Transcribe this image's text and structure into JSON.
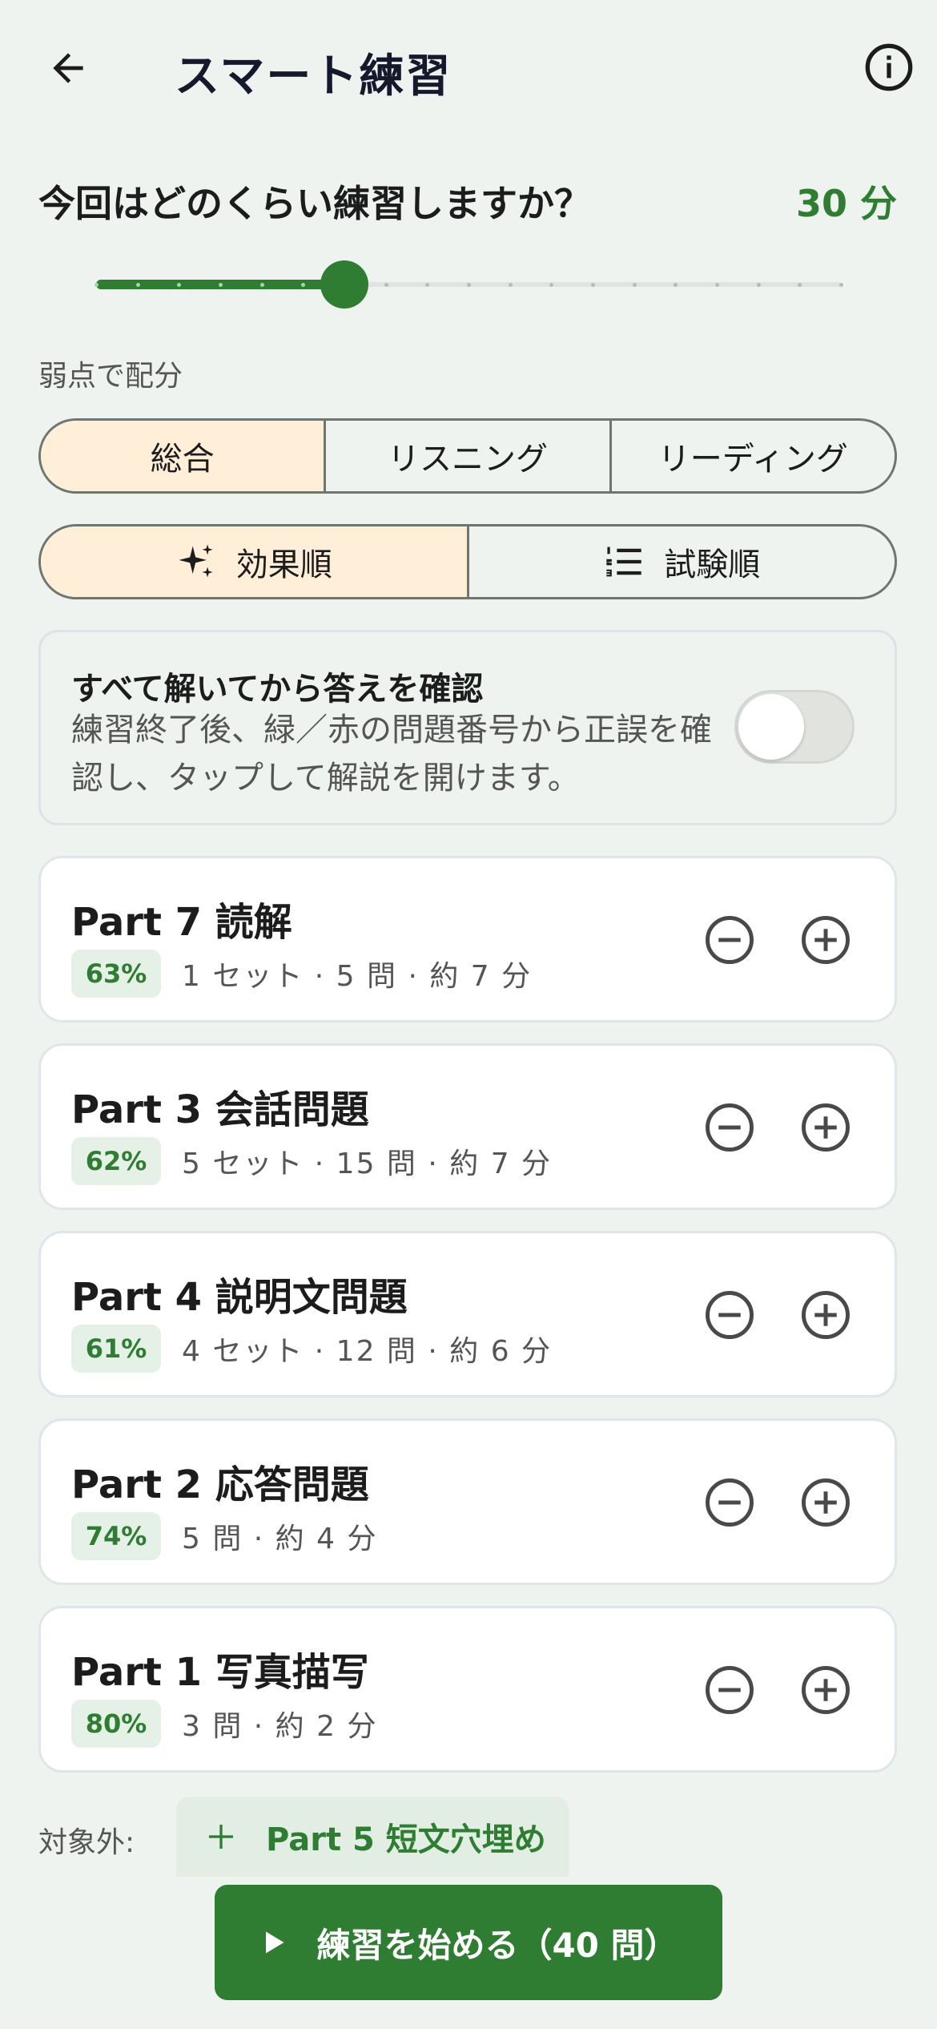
{
  "header": {
    "title": "スマート練習"
  },
  "time": {
    "question": "今回はどのくらい練習しますか？",
    "value_label": "30 分",
    "slider_steps": 19,
    "slider_value_step": 6
  },
  "allocation": {
    "label": "弱点で配分",
    "options": [
      "総合",
      "リスニング",
      "リーディング"
    ],
    "selected": "総合"
  },
  "order": {
    "options": [
      "効果順",
      "試験順"
    ],
    "selected": "効果順"
  },
  "review_toggle": {
    "title": "すべて解いてから答えを確認",
    "description": "練習終了後、緑／赤の問題番号から正誤を確認し、タップして解説を開けます。",
    "enabled": false
  },
  "parts": [
    {
      "title": "Part 7 読解",
      "accuracy": "63%",
      "meta": "1 セット · 5 問 · 約 7 分"
    },
    {
      "title": "Part 3 会話問題",
      "accuracy": "62%",
      "meta": "5 セット · 15 問 · 約 7 分"
    },
    {
      "title": "Part 4 説明文問題",
      "accuracy": "61%",
      "meta": "4 セット · 12 問 · 約 6 分"
    },
    {
      "title": "Part 2 応答問題",
      "accuracy": "74%",
      "meta": "5 問 · 約 4 分"
    },
    {
      "title": "Part 1 写真描写",
      "accuracy": "80%",
      "meta": "3 問 · 約 2 分"
    }
  ],
  "excluded": {
    "label": "対象外:",
    "chip_label": "Part 5 短文穴埋め"
  },
  "start_button": {
    "label": "練習を始める（40 問）"
  },
  "colors": {
    "accent": "#2E7D32",
    "selected_segment": "#FFEFD9",
    "background": "#EEF3EF"
  },
  "icons": {
    "back": "arrow-left-icon",
    "info": "info-icon",
    "effect": "sparkle-icon",
    "exam_order": "numbered-list-icon",
    "minus": "minus-circle-icon",
    "plus": "plus-circle-icon",
    "play": "play-icon"
  }
}
